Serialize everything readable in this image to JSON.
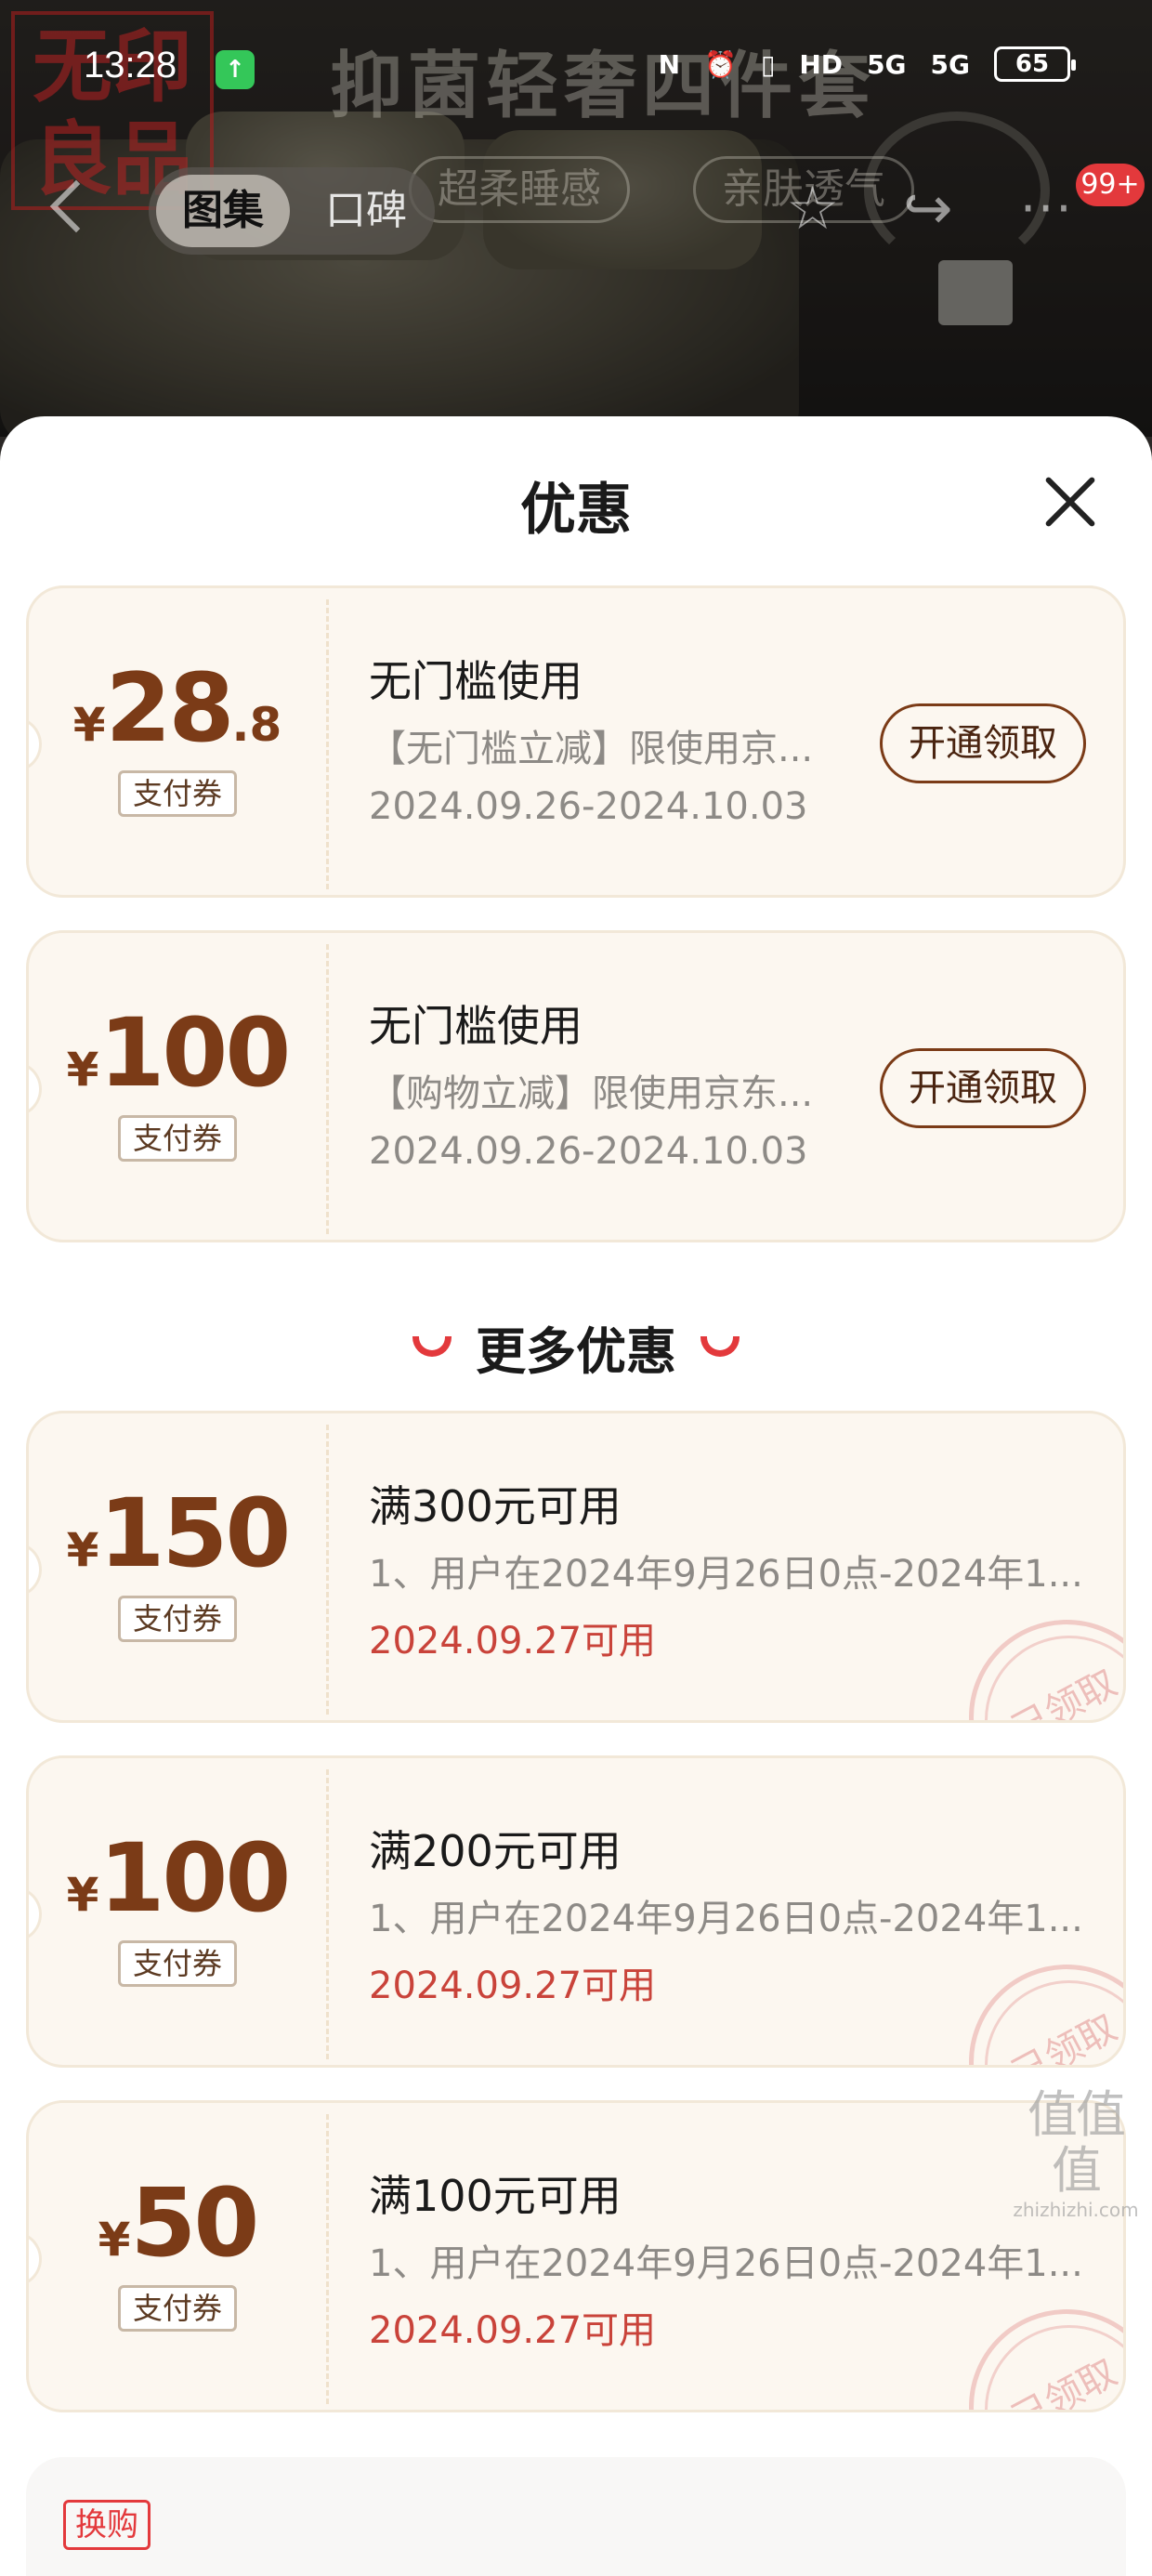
{
  "status_bar": {
    "time": "13:28",
    "icons": [
      "N",
      "⏰",
      "▯",
      "HD",
      "5G",
      "5G"
    ],
    "battery": "65"
  },
  "hero": {
    "logo_line1": "无印",
    "logo_line2": "良品",
    "banner_title": "抑菌轻奢四件套",
    "tags": [
      "超柔睡感",
      "亲肤透气"
    ],
    "badge": "99+"
  },
  "nav": {
    "tabs": [
      "图集",
      "口碑"
    ],
    "icons": [
      "back-icon",
      "star-icon",
      "share-icon",
      "more-icon"
    ]
  },
  "sheet": {
    "title": "优惠",
    "more_title": "更多优惠",
    "currency": "¥",
    "pay_tag": "支付券"
  },
  "coupons": [
    {
      "int": "28",
      "dec": ".8",
      "title": "无门槛使用",
      "desc": "【无门槛立减】限使用京...",
      "date": "2024.09.26-2024.10.03",
      "button": "开通领取"
    },
    {
      "int": "100",
      "dec": "",
      "title": "无门槛使用",
      "desc": "【购物立减】限使用京东...",
      "date": "2024.09.26-2024.10.03",
      "button": "开通领取"
    }
  ],
  "more_coupons": [
    {
      "int": "150",
      "title": "满300元可用",
      "desc": "1、用户在2024年9月26日0点-2024年1...",
      "date": "2024.09.27可用",
      "stamp": "已领取"
    },
    {
      "int": "100",
      "title": "满200元可用",
      "desc": "1、用户在2024年9月26日0点-2024年1...",
      "date": "2024.09.27可用",
      "stamp": "已领取"
    },
    {
      "int": "50",
      "title": "满100元可用",
      "desc": "1、用户在2024年9月26日0点-2024年1...",
      "date": "2024.09.27可用",
      "stamp": "已领取"
    }
  ],
  "swap": {
    "tag": "换购"
  },
  "watermark": {
    "main": "值值值",
    "sub": "zhizhizhi.com"
  },
  "colors": {
    "accent": "#e3393c",
    "amount": "#7b3b17",
    "coupon_bg": "#fcf7f0",
    "red_date": "#c9433a"
  }
}
